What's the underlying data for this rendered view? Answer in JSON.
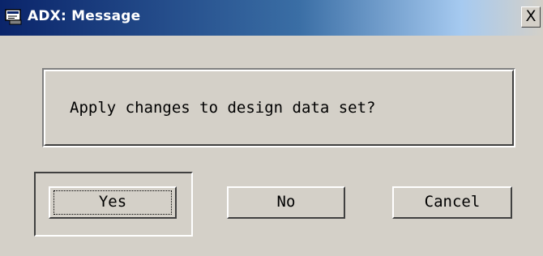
{
  "window": {
    "title": "ADX: Message",
    "icon": "message-window-icon",
    "close_label": "X"
  },
  "message": {
    "text": "Apply changes to design data set?"
  },
  "buttons": {
    "yes_label": "Yes",
    "no_label": "No",
    "cancel_label": "Cancel",
    "default": "Yes"
  },
  "colors": {
    "dialog_background": "#d4d0c8",
    "titlebar_start": "#0a246a",
    "titlebar_end": "#a6caf0",
    "title_text": "#ffffff"
  }
}
